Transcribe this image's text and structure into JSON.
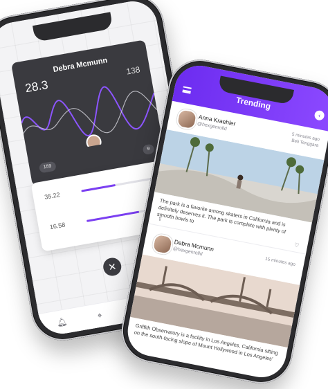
{
  "left_phone": {
    "card": {
      "name": "Debra Mcmunn",
      "subtitle": "",
      "metric_left": "28.3",
      "metric_right": "138",
      "pill_left": "159",
      "pill_right": "9"
    },
    "rows": [
      {
        "value": "35.22",
        "fill": 0.45
      },
      {
        "value": "16.58",
        "fill": 0.7
      }
    ],
    "close_icon": "close-icon",
    "tabs": [
      "bell-icon",
      "location-pin-icon",
      "drop-icon",
      "user-icon"
    ]
  },
  "right_phone": {
    "header": {
      "title": "Trending"
    },
    "posts": [
      {
        "author": "Anna Kraehler",
        "handle": "@hexgenrolld",
        "time": "5 minutes ago",
        "time_sub": "Beli Tenggara",
        "caption": "The park is a favorite among skaters in California and is definitely deserves it. The park is complete with plenty of smooth bowls to"
      },
      {
        "author": "Debra Mcmunn",
        "handle": "@hexgenrolld",
        "time": "15 minutes ago",
        "time_sub": "",
        "caption": "Griffith Observatory is a facility in Los Angeles, California sitting on the south-facing slope of Mount Hollywood in Los Angeles'"
      }
    ],
    "accent": "#7b3ff2"
  }
}
